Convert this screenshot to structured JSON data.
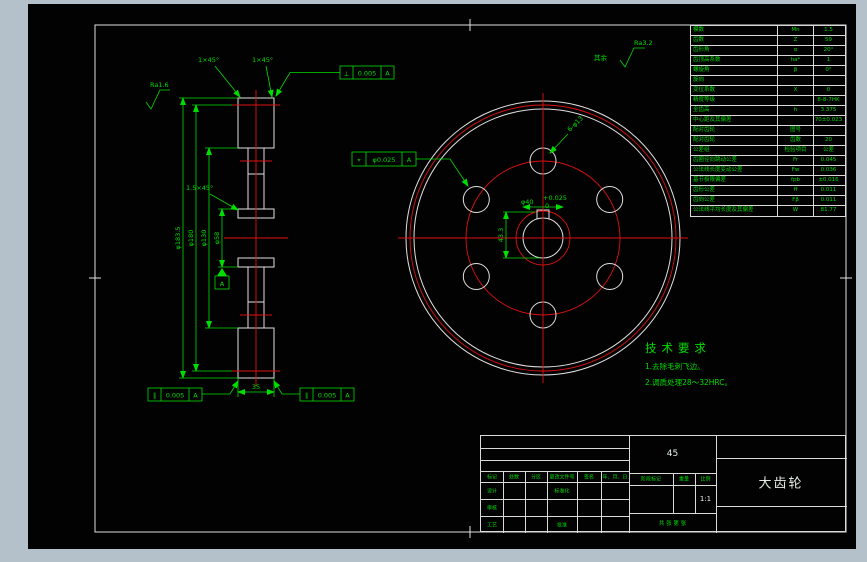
{
  "colors": {
    "frame_bg": "#b4c1ca",
    "paper": "#020202",
    "line": "#e0e0e0",
    "annot_green": "#00dd00",
    "center_red": "#dd1111"
  },
  "roughness": {
    "left": "Ra1.6",
    "other_label": "其余",
    "other_value": "Ra3.2"
  },
  "chamfers": [
    "1×45°",
    "1×45°",
    "1.5×45°"
  ],
  "section": {
    "dims": [
      "φ183.5",
      "φ180",
      "φ130",
      "φ58"
    ],
    "width": "35",
    "datum": "A"
  },
  "front": {
    "bore": "φ40",
    "bore_tol_up": "+0.025",
    "bore_tol_dn": "0",
    "keyway": "43.3",
    "holes": "6-φ13"
  },
  "tol": {
    "top": {
      "sym": "⟂",
      "val": "0.005",
      "datum": "A"
    },
    "pos": {
      "sym": "⌖",
      "val": "φ0.025",
      "datum": "A"
    },
    "bl": {
      "sym": "∥",
      "val": "0.005",
      "datum": "A"
    },
    "br": {
      "sym": "∥",
      "val": "0.005",
      "datum": "A"
    }
  },
  "tech": {
    "title": "技术要求",
    "items": [
      "1.去除毛刺飞边。",
      "2.调质处理28～32HRC。"
    ]
  },
  "pt": {
    "rows": [
      {
        "label": "模数",
        "sym": "Mn",
        "val": "1.5"
      },
      {
        "label": "齿数",
        "sym": "Z",
        "val": "59"
      },
      {
        "label": "齿形角",
        "sym": "α",
        "val": "20°"
      },
      {
        "label": "齿顶高系数",
        "sym": "ha*",
        "val": "1"
      },
      {
        "label": "螺旋角",
        "sym": "β",
        "val": "0°"
      },
      {
        "label": "旋向",
        "sym": "",
        "val": ""
      },
      {
        "label": "变位系数",
        "sym": "X",
        "val": "0"
      },
      {
        "label": "精度等级",
        "sym": "",
        "val": "8-8-7HK"
      },
      {
        "label": "全齿高",
        "sym": "h",
        "val": "3.375"
      },
      {
        "label": "中心距及其偏差",
        "sym": "",
        "val": "70±0.023"
      },
      {
        "label": "配对齿轮",
        "sym": "图号",
        "val": ""
      },
      {
        "label": "配对齿轮",
        "sym": "齿数",
        "val": "20"
      },
      {
        "label": "公差组",
        "sym": "检验项目",
        "val": "公差"
      },
      {
        "label": "齿圈径向跳动公差",
        "sym": "Fr",
        "val": "0.045"
      },
      {
        "label": "公法线长度变动公差",
        "sym": "Fw",
        "val": "0.036"
      },
      {
        "label": "基节极限偏差",
        "sym": "fpb",
        "val": "±0.016"
      },
      {
        "label": "齿形公差",
        "sym": "ff",
        "val": "0.011"
      },
      {
        "label": "齿向公差",
        "sym": "Fβ",
        "val": "0.011"
      },
      {
        "label": "公法线平均长度及其偏差",
        "sym": "W",
        "val": "81.77"
      }
    ]
  },
  "tb": {
    "material": "45",
    "name": "大齿轮",
    "scale_value": "1:1",
    "stage": "阶段标记",
    "weight": "重量",
    "scale": "比例",
    "sheets": "共 张 第 张",
    "rev": [
      "标记",
      "处数",
      "分区",
      "更改文件号",
      "签名",
      "年、月、日"
    ],
    "design": "设计",
    "standard": "标准化",
    "check": "审核",
    "craft": "工艺",
    "approve": "批准"
  }
}
